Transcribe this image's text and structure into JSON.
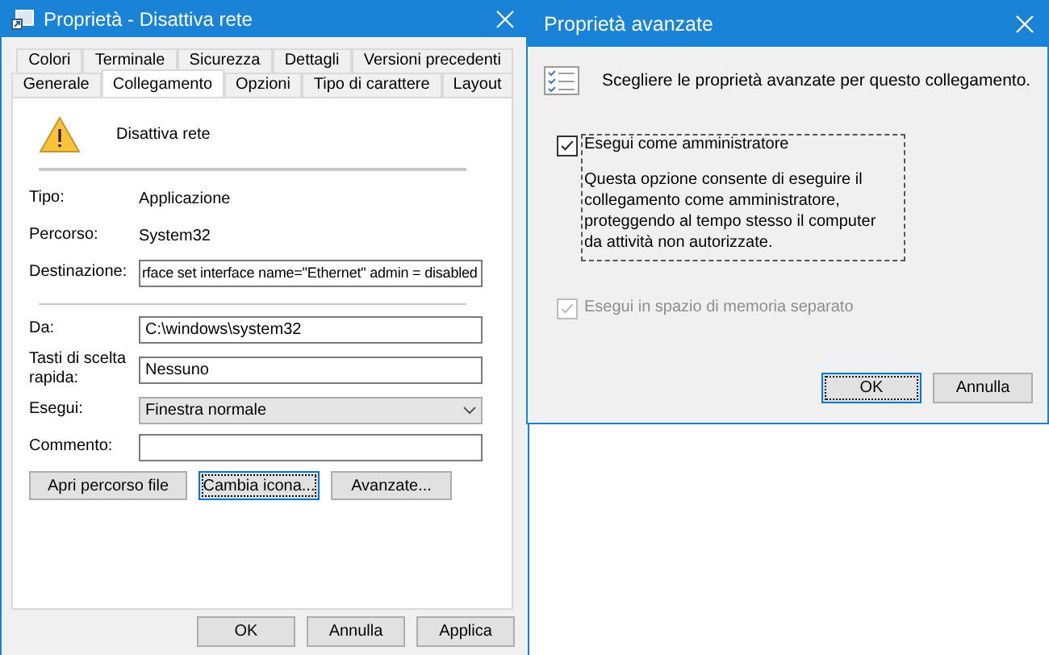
{
  "properties_window": {
    "title": "Proprietà - Disattiva rete",
    "tab_rows": [
      [
        {
          "label": "Colori",
          "selected": false
        },
        {
          "label": "Terminale",
          "selected": false
        },
        {
          "label": "Sicurezza",
          "selected": false
        },
        {
          "label": "Dettagli",
          "selected": false
        },
        {
          "label": "Versioni precedenti",
          "selected": false
        }
      ],
      [
        {
          "label": "Generale",
          "selected": false
        },
        {
          "label": "Collegamento",
          "selected": true
        },
        {
          "label": "Opzioni",
          "selected": false
        },
        {
          "label": "Tipo di carattere",
          "selected": false
        },
        {
          "label": "Layout",
          "selected": false
        }
      ]
    ],
    "shortcut_name": "Disattiva rete",
    "info": [
      {
        "label": "Tipo:",
        "value": "Applicazione"
      },
      {
        "label": "Percorso:",
        "value": "System32"
      }
    ],
    "target": {
      "label": "Destinazione:",
      "value": "rface set interface name=\"Ethernet\" admin = disabled"
    },
    "fields": [
      {
        "kind": "text",
        "label": "Da:",
        "value": "C:\\windows\\system32"
      },
      {
        "kind": "text",
        "label": "Tasti di scelta rapida:",
        "value": "Nessuno"
      },
      {
        "kind": "select",
        "label": "Esegui:",
        "value": "Finestra normale"
      },
      {
        "kind": "text",
        "label": "Commento:"
      }
    ],
    "actions": [
      {
        "label": "Apri percorso file",
        "focused": false
      },
      {
        "label": "Cambia icona...",
        "focused": true
      },
      {
        "label": "Avanzate...",
        "focused": false
      }
    ],
    "buttons": [
      {
        "label": "OK",
        "focused": false
      },
      {
        "label": "Annulla",
        "focused": false
      },
      {
        "label": "Applica",
        "focused": false
      }
    ]
  },
  "advanced_window": {
    "title": "Proprietà avanzate",
    "intro": "Scegliere le proprietà avanzate per questo collegamento.",
    "options": [
      {
        "label": "Esegui come amministratore",
        "checked": true,
        "disabled": false,
        "focused": true,
        "description": "Questa opzione consente di eseguire il collegamento come amministratore, proteggendo al tempo stesso il computer da attività non autorizzate."
      },
      {
        "label": "Esegui in spazio di memoria separato",
        "checked": true,
        "disabled": true,
        "focused": false
      }
    ],
    "buttons": [
      {
        "label": "OK",
        "focused": true
      },
      {
        "label": "Annulla",
        "focused": false
      }
    ]
  }
}
